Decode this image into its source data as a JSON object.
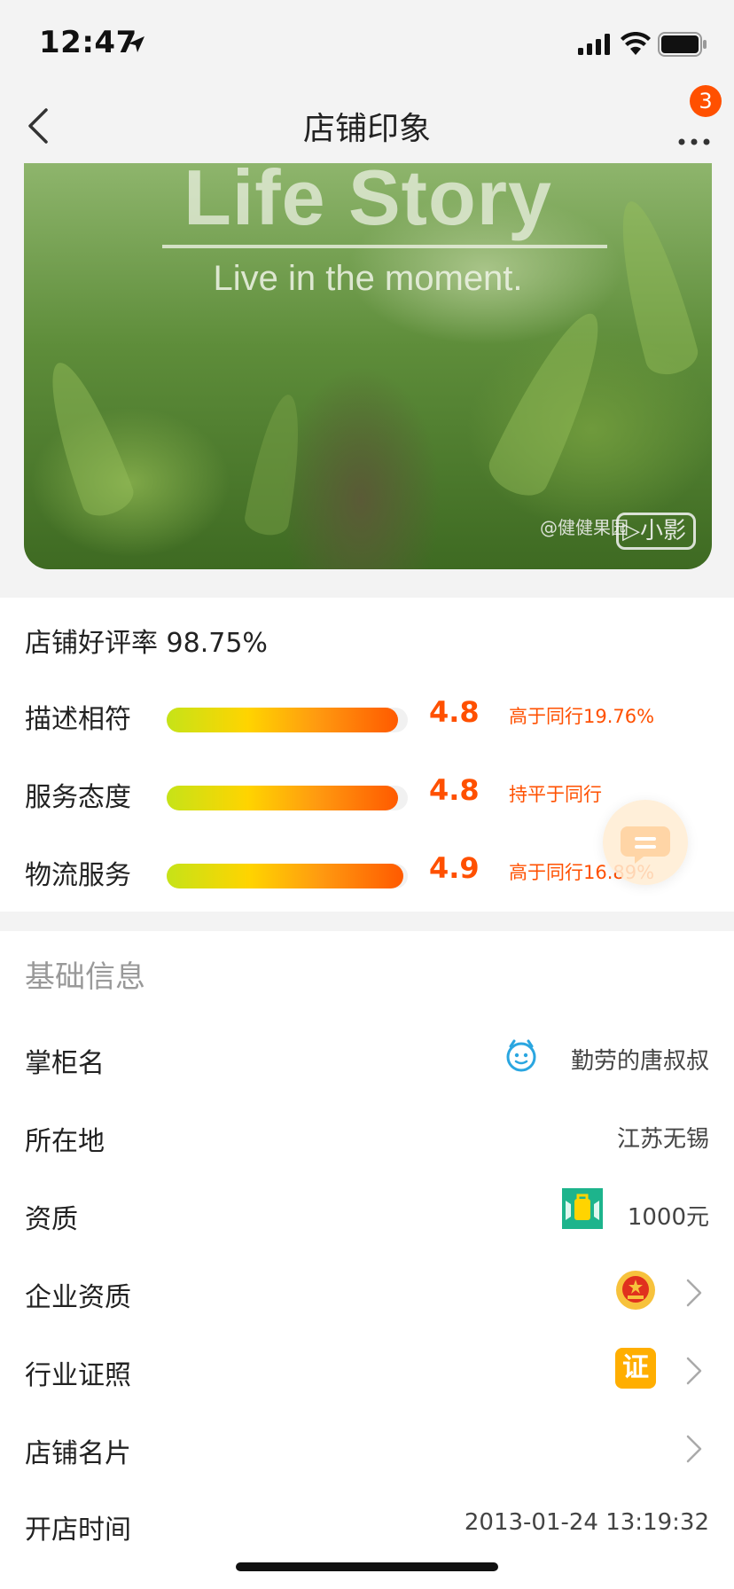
{
  "status_bar": {
    "time": "12:47",
    "icons": [
      "location-arrow-icon",
      "cellular-signal-icon",
      "wifi-icon",
      "battery-icon"
    ]
  },
  "nav": {
    "title": "店铺印象",
    "back_icon": "chevron-left-icon",
    "more_icon": "more-dots-icon",
    "notification_count": "3"
  },
  "banner": {
    "title": "Life Story",
    "subtitle": "Live in the moment.",
    "watermark": "@健健果园",
    "watermark_logo": "▷小影"
  },
  "ratings": {
    "summary_label": "店铺好评率",
    "summary_value": "98.75%",
    "rows": [
      {
        "label": "描述相符",
        "score": "4.8",
        "compare": "高于同行19.76%",
        "fill": 0.96
      },
      {
        "label": "服务态度",
        "score": "4.8",
        "compare": "持平于同行",
        "fill": 0.96
      },
      {
        "label": "物流服务",
        "score": "4.9",
        "compare": "高于同行16.89%",
        "fill": 0.98
      }
    ]
  },
  "basic_info": {
    "section_title": "基础信息",
    "rows": [
      {
        "label": "掌柜名",
        "value": "勤劳的唐叔叔",
        "icon": "smiley-face-icon"
      },
      {
        "label": "所在地",
        "value": "江苏无锡"
      },
      {
        "label": "资质",
        "value": "1000元",
        "icon": "deposit-bag-icon"
      },
      {
        "label": "企业资质",
        "value": "",
        "icon": "national-emblem-icon"
      },
      {
        "label": "行业证照",
        "value": "",
        "icon": "certificate-icon",
        "icon_text": "证"
      },
      {
        "label": "店铺名片",
        "value": ""
      },
      {
        "label": "开店时间",
        "value": "2013-01-24 13:19:32"
      }
    ]
  },
  "colors": {
    "accent": "#ff5000",
    "section_title": "#999999",
    "background": "#f3f3f3"
  }
}
